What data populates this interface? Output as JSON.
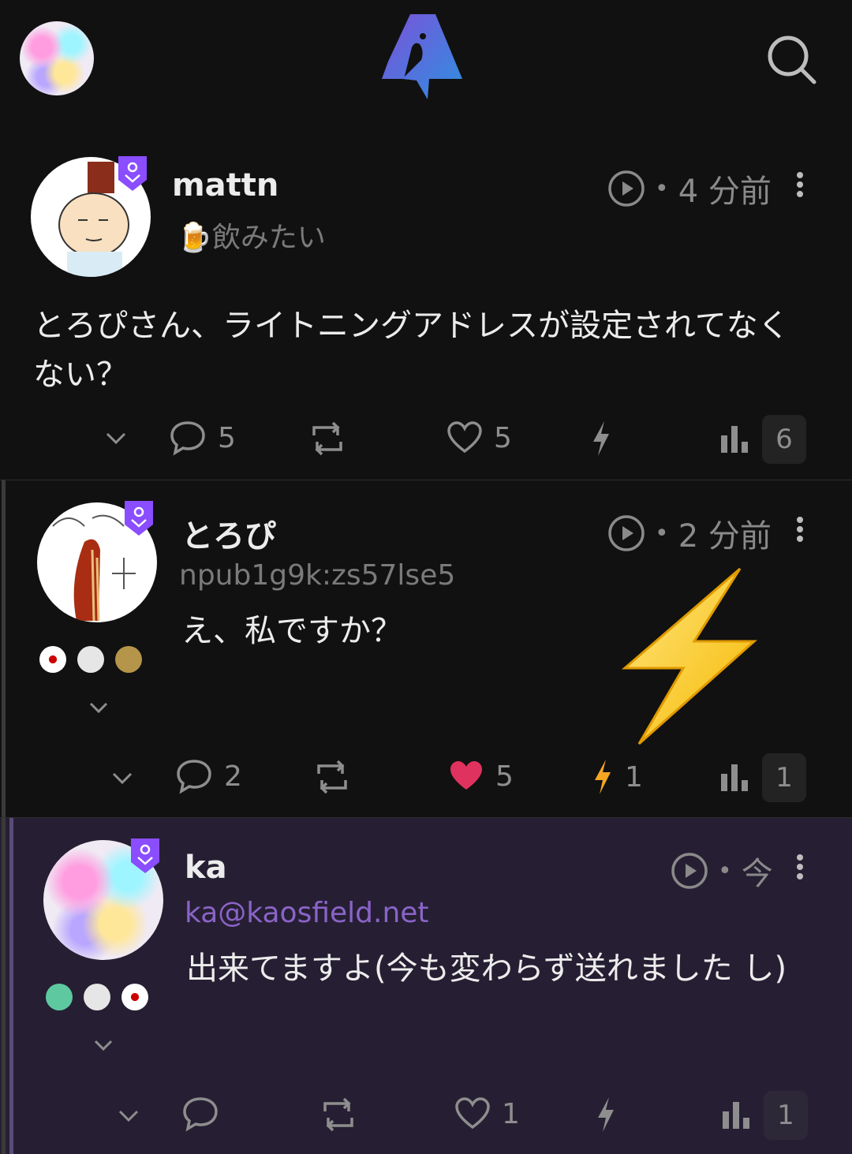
{
  "header": {
    "logo_icon": "nostter-goose-logo",
    "search_icon": "search-icon"
  },
  "posts": [
    {
      "author": "mattn",
      "status": "🍺飲みたい",
      "time": "4 分前",
      "content": "とろぴさん、ライトニングアドレスが設定されてなくない？",
      "replies": "5",
      "likes": "5",
      "zaps": "",
      "views": "6"
    },
    {
      "author": "とろぴ",
      "subtitle": "npub1g9k:zs57lse5",
      "time": "2 分前",
      "content": "え、私ですか？",
      "replies": "2",
      "likes": "5",
      "zaps": "1",
      "views": "1"
    },
    {
      "author": "ka",
      "subtitle": "ka@kaosfield.net",
      "time": "今",
      "content": "出来てますよ(今も変わらず送れました し)",
      "replies": "",
      "likes": "1",
      "zaps": "",
      "views": "1"
    }
  ],
  "colors": {
    "background": "#111111",
    "highlight_background": "#261f33",
    "accent_purple": "#8a4dff",
    "like_red": "#e0325e",
    "zap_orange": "#f5a623",
    "nip05_purple": "#8a64c8"
  }
}
